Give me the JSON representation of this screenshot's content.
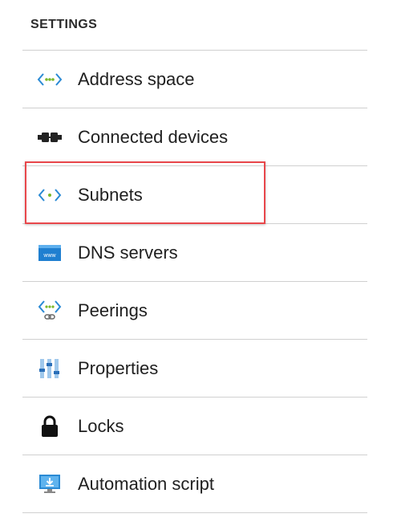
{
  "section": {
    "title": "SETTINGS"
  },
  "menu": {
    "items": [
      {
        "label": "Address space",
        "icon": "address-space-icon"
      },
      {
        "label": "Connected devices",
        "icon": "connected-devices-icon"
      },
      {
        "label": "Subnets",
        "icon": "subnets-icon"
      },
      {
        "label": "DNS servers",
        "icon": "dns-servers-icon"
      },
      {
        "label": "Peerings",
        "icon": "peerings-icon"
      },
      {
        "label": "Properties",
        "icon": "properties-icon"
      },
      {
        "label": "Locks",
        "icon": "lock-icon"
      },
      {
        "label": "Automation script",
        "icon": "automation-script-icon"
      }
    ],
    "highlighted_item": "Subnets"
  },
  "colors": {
    "highlight_border": "#e8474b",
    "icon_blue": "#2a8ad4",
    "icon_green": "#7ab829",
    "divider": "#d0d0d0"
  }
}
